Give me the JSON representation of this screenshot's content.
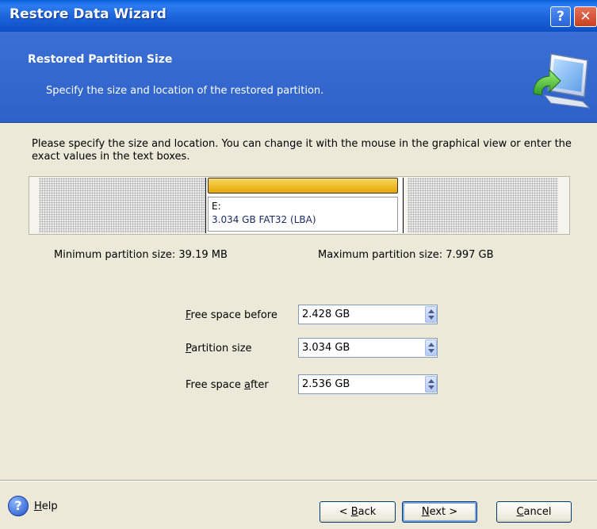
{
  "window": {
    "title": "Restore Data Wizard",
    "help_glyph": "?",
    "close_glyph": "✕"
  },
  "header": {
    "title": "Restored Partition Size",
    "subtitle": "Specify the size and location of the restored partition."
  },
  "instructions": "Please specify the size and location. You can change it with the mouse in the graphical view or enter the exact values in the text boxes.",
  "partition_view": {
    "letter": "E:",
    "info": "3.034 GB  FAT32 (LBA)"
  },
  "limits": {
    "min": "Minimum partition size:  39.19 MB",
    "max": "Maximum partition size:  7.997 GB"
  },
  "fields": {
    "free_before": {
      "label_accel": "F",
      "label_rest": "ree space before",
      "value": "2.428 GB"
    },
    "partition_size": {
      "label_accel": "P",
      "label_rest": "artition size",
      "value": "3.034 GB"
    },
    "free_after": {
      "label_pre": "Free space ",
      "label_accel": "a",
      "label_rest": "fter",
      "value": "2.536 GB"
    }
  },
  "footer": {
    "help_label_accel": "H",
    "help_label_rest": "elp",
    "back_pre": "< ",
    "back_accel": "B",
    "back_rest": "ack",
    "next_accel": "N",
    "next_rest": "ext >",
    "cancel_accel": "C",
    "cancel_rest": "ancel"
  },
  "colors": {
    "title_bar": "#1d63d9",
    "header_bg": "#3366cc",
    "partition_bar": "#e8a801",
    "dialog_bg": "#ece9d8"
  },
  "icons": [
    "help-icon",
    "close-icon",
    "computer-restore-icon",
    "spinner-icon",
    "help-circle-icon"
  ]
}
